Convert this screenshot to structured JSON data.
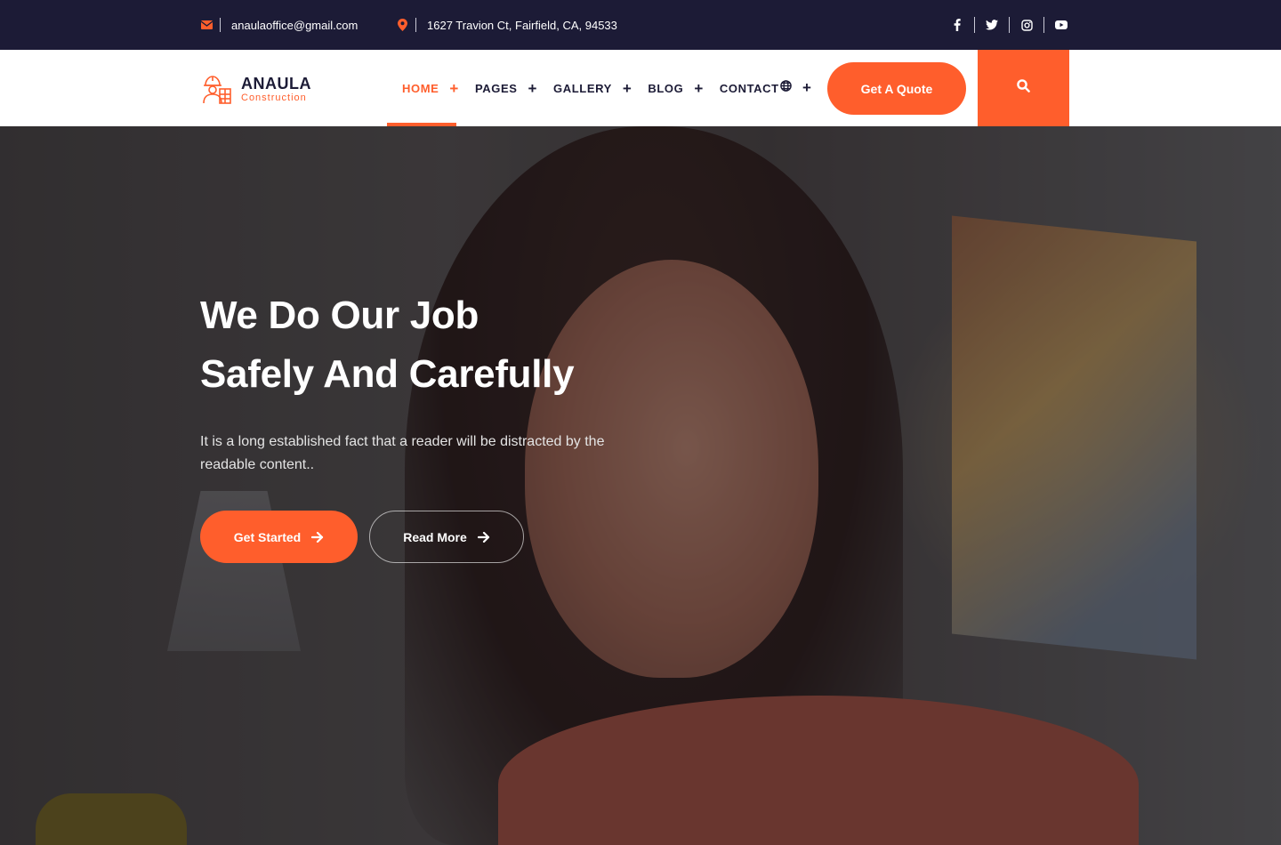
{
  "topbar": {
    "email": "anaulaoffice@gmail.com",
    "address": "1627 Travion Ct, Fairfield, CA, 94533",
    "social_icons": [
      "facebook-icon",
      "twitter-icon",
      "instagram-icon",
      "youtube-icon"
    ]
  },
  "brand": {
    "name": "ANAULA",
    "tagline": "Construction"
  },
  "nav": {
    "items": [
      {
        "label": "HOME",
        "active": true
      },
      {
        "label": "PAGES"
      },
      {
        "label": "GALLERY"
      },
      {
        "label": "BLOG"
      },
      {
        "label": "CONTACT"
      }
    ],
    "quote_button": "Get A Quote"
  },
  "hero": {
    "title_line1": "We Do Our Job",
    "title_line2": "Safely And Carefully",
    "text": "It is a long established fact that a reader will be distracted by the readable content..",
    "primary_button": "Get Started",
    "secondary_button": "Read More"
  },
  "colors": {
    "accent": "#ff5e2c",
    "dark": "#1c1b36"
  }
}
